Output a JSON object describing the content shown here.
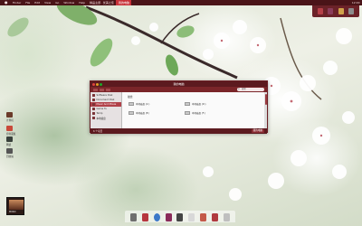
{
  "menubar": {
    "apple_label": "",
    "items": [
      "Finder",
      "File",
      "Edit",
      "View",
      "Go",
      "Window",
      "Help"
    ],
    "active_items": [
      "精品主题 · 优美之佳"
    ],
    "active_label": "我的电脑",
    "clock": "12:00"
  },
  "top_dock": {
    "icons": [
      {
        "name": "apps-icon",
        "color": "#b54048"
      },
      {
        "name": "user-icon",
        "color": "#8a3c5a"
      },
      {
        "name": "star-icon",
        "color": "#d0a24a"
      },
      {
        "name": "trash-icon",
        "color": "#8c8c8c"
      }
    ]
  },
  "desktop": {
    "icons": [
      {
        "label": "计算机",
        "color": "#6b3b2a"
      },
      {
        "label": "控制面板",
        "color": "#c94a3a"
      },
      {
        "label": "网络",
        "color": "#38403a"
      },
      {
        "label": "回收站",
        "color": "#555555"
      }
    ]
  },
  "window": {
    "title": "我的电脑",
    "search_placeholder": "搜索",
    "sidebar": [
      {
        "label": "Software Disk"
      },
      {
        "label": "Document Disk"
      },
      {
        "label": "Music And Movie"
      },
      {
        "label": "Game Tu"
      },
      {
        "label": "Temp"
      },
      {
        "label": "本地磁盘"
      }
    ],
    "selected_sidebar": 2,
    "content_header": "磁盘",
    "items": [
      {
        "label": "本地磁盘 (C:)"
      },
      {
        "label": "本地磁盘 (D:)"
      },
      {
        "label": "本地磁盘 (E:)"
      },
      {
        "label": "本地磁盘 (F:)"
      }
    ],
    "status_left": "6 个项目",
    "status_button": "我的电脑"
  },
  "dock": {
    "icons": [
      {
        "name": "system-icon",
        "color": "#6e6e6e"
      },
      {
        "name": "mail-icon",
        "color": "#b6363e"
      },
      {
        "name": "globe-icon",
        "color": "#3c78c8"
      },
      {
        "name": "music-icon",
        "color": "#8a2b5a"
      },
      {
        "name": "chat-icon",
        "color": "#444444"
      },
      {
        "name": "tag-icon",
        "color": "#d8d8d8"
      },
      {
        "name": "photo-icon",
        "color": "#c45a4a"
      },
      {
        "name": "briefcase-icon",
        "color": "#b03a3f"
      },
      {
        "name": "trash-icon",
        "color": "#bfbfbf"
      }
    ]
  },
  "widget": {
    "label": "MUSIC"
  },
  "colors": {
    "menubar": "#4a1418",
    "accent": "#b14149",
    "window_chrome": "#5c1a1f"
  }
}
